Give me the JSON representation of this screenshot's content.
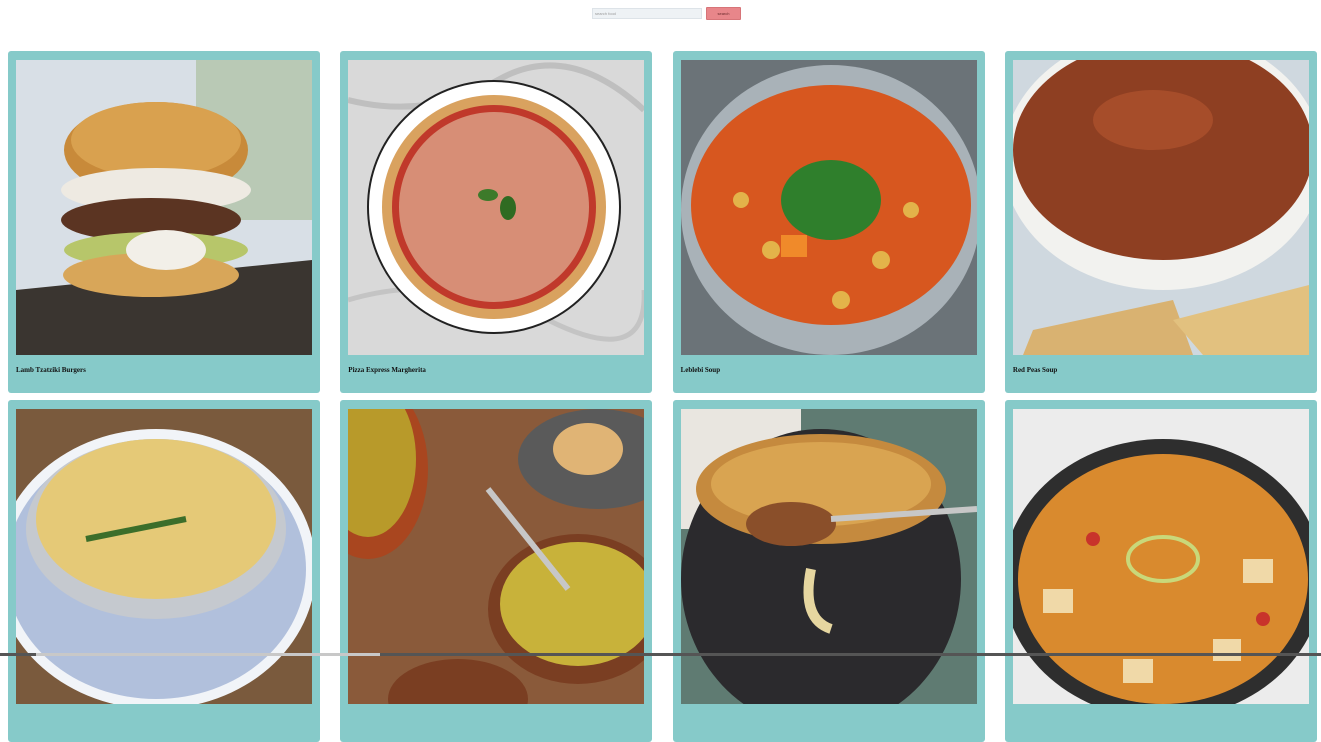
{
  "search": {
    "placeholder": "search food",
    "button_label": "search"
  },
  "recipes": [
    {
      "title": "Lamb Tzatziki Burgers",
      "image": "burger"
    },
    {
      "title": "Pizza Express Margherita",
      "image": "pizza"
    },
    {
      "title": "Leblebi Soup",
      "image": "leblebi-soup"
    },
    {
      "title": "Red Peas Soup",
      "image": "red-peas-soup"
    },
    {
      "title": "",
      "image": "egg-drop-soup"
    },
    {
      "title": "",
      "image": "split-pea-soup"
    },
    {
      "title": "",
      "image": "french-onion-soup"
    },
    {
      "title": "",
      "image": "hot-sour-soup"
    }
  ],
  "colors": {
    "card_background": "#86cac9",
    "search_button": "#e8868a"
  }
}
